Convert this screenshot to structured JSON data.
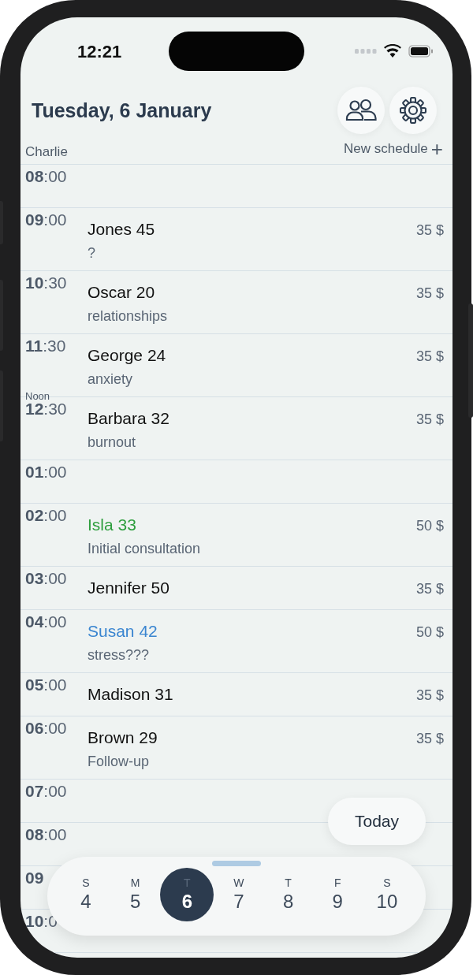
{
  "status_bar": {
    "time": "12:21"
  },
  "header": {
    "title": "Tuesday, 6 January",
    "calendar_name": "Charlie",
    "new_schedule": "New schedule",
    "new_schedule_icon": "+"
  },
  "rows": [
    {
      "hour": "08",
      "minutes": ":00"
    },
    {
      "hour": "09",
      "minutes": ":00",
      "appointment": {
        "name": "Jones 45",
        "color": "#111111",
        "note": "?",
        "price": "35 $"
      }
    },
    {
      "hour": "10",
      "minutes": ":30",
      "appointment": {
        "name": "Oscar 20",
        "color": "#111111",
        "note": "relationships",
        "price": "35 $"
      }
    },
    {
      "hour": "11",
      "minutes": ":30",
      "appointment": {
        "name": "George 24",
        "color": "#111111",
        "note": "anxiety",
        "price": "35 $"
      }
    },
    {
      "label": "Noon",
      "hour": "12",
      "minutes": ":30",
      "appointment": {
        "name": "Barbara 32",
        "color": "#111111",
        "note": "burnout",
        "price": "35 $"
      }
    },
    {
      "hour": "01",
      "minutes": ":00"
    },
    {
      "hour": "02",
      "minutes": ":00",
      "appointment": {
        "name": "Isla 33",
        "color": "#2e9e3e",
        "note": "Initial consultation",
        "price": "50 $"
      }
    },
    {
      "hour": "03",
      "minutes": ":00",
      "appointment": {
        "name": "Jennifer 50",
        "color": "#111111",
        "price": "35 $"
      }
    },
    {
      "hour": "04",
      "minutes": ":00",
      "appointment": {
        "name": "Susan 42",
        "color": "#3a85d0",
        "note": "stress???",
        "price": "50 $"
      }
    },
    {
      "hour": "05",
      "minutes": ":00",
      "appointment": {
        "name": "Madison 31",
        "color": "#111111",
        "price": "35 $"
      }
    },
    {
      "hour": "06",
      "minutes": ":00",
      "appointment": {
        "name": "Brown 29",
        "color": "#111111",
        "note": "Follow-up",
        "price": "35 $"
      }
    },
    {
      "hour": "07",
      "minutes": ":00"
    },
    {
      "hour": "08",
      "minutes": ":00"
    },
    {
      "hour": "09"
    },
    {
      "hour": "10",
      "minutes": ":0"
    }
  ],
  "today_button": "Today",
  "week": [
    {
      "letter": "S",
      "day": "4",
      "selected": false
    },
    {
      "letter": "M",
      "day": "5",
      "selected": false
    },
    {
      "letter": "T",
      "day": "6",
      "selected": true
    },
    {
      "letter": "W",
      "day": "7",
      "selected": false
    },
    {
      "letter": "T",
      "day": "8",
      "selected": false
    },
    {
      "letter": "F",
      "day": "9",
      "selected": false
    },
    {
      "letter": "S",
      "day": "10",
      "selected": false
    }
  ]
}
